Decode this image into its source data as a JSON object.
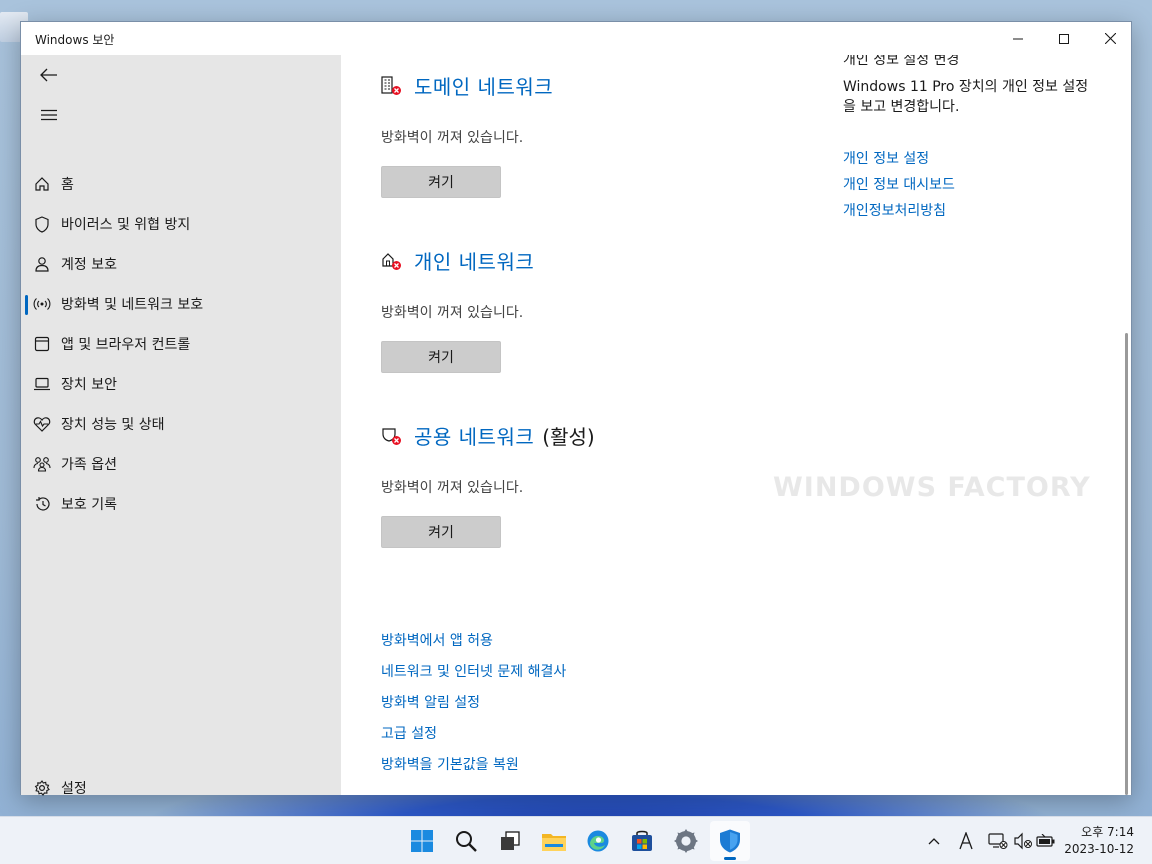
{
  "window": {
    "title": "Windows 보안"
  },
  "sidebar": {
    "items": [
      {
        "label": "홈",
        "icon": "home-icon"
      },
      {
        "label": "바이러스 및 위협 방지",
        "icon": "shield-icon"
      },
      {
        "label": "계정 보호",
        "icon": "person-icon"
      },
      {
        "label": "방화벽 및 네트워크 보호",
        "icon": "antenna-icon",
        "selected": true
      },
      {
        "label": "앱 및 브라우저 컨트롤",
        "icon": "app-window-icon"
      },
      {
        "label": "장치 보안",
        "icon": "laptop-icon"
      },
      {
        "label": "장치 성능 및 상태",
        "icon": "heart-pulse-icon"
      },
      {
        "label": "가족 옵션",
        "icon": "family-icon"
      },
      {
        "label": "보호 기록",
        "icon": "history-icon"
      }
    ],
    "settings_label": "설정"
  },
  "networks": [
    {
      "name": "도메인 네트워크",
      "suffix": "",
      "status": "방화벽이 꺼져 있습니다.",
      "button": "켜기",
      "icon": "domain-network-icon"
    },
    {
      "name": "개인 네트워크",
      "suffix": "",
      "status": "방화벽이 꺼져 있습니다.",
      "button": "켜기",
      "icon": "private-network-icon"
    },
    {
      "name": "공용 네트워크",
      "suffix": "(활성)",
      "status": "방화벽이 꺼져 있습니다.",
      "button": "켜기",
      "icon": "public-network-icon"
    }
  ],
  "links": [
    "방화벽에서 앱 허용",
    "네트워크 및 인터넷 문제 해결사",
    "방화벽 알림 설정",
    "고급 설정",
    "방화벽을 기본값을 복원"
  ],
  "right_panel": {
    "heading": "개인 정보 설정 변경",
    "description": "Windows 11 Pro 장치의 개인 정보 설정을 보고 변경합니다.",
    "links": [
      "개인 정보 설정",
      "개인 정보 대시보드",
      "개인정보처리방침"
    ]
  },
  "watermark": "WINDOWS FACTORY",
  "taskbar": {
    "apps": [
      "start-icon",
      "search-icon",
      "task-view-icon",
      "file-explorer-icon",
      "edge-icon",
      "store-icon",
      "settings-icon",
      "windows-security-icon"
    ],
    "tray": [
      "chevron-up-icon",
      "ime-icon",
      "network-icon",
      "volume-muted-icon",
      "battery-icon"
    ],
    "time": "오후 7:14",
    "date": "2023-10-12"
  },
  "colors": {
    "accent": "#0067c0",
    "sidebar_bg": "#e6e6e6",
    "error": "#e81123"
  }
}
